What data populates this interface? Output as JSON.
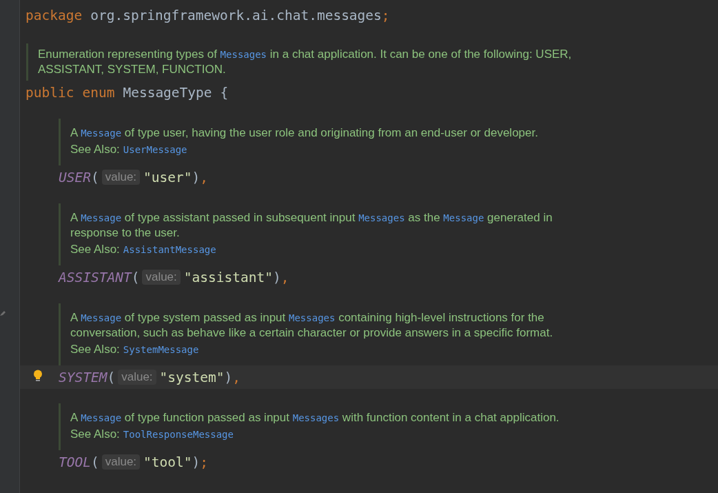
{
  "editor": {
    "package_line": {
      "keyword": "package",
      "name": "org.springframework.ai.chat.messages",
      "end": ";"
    },
    "class_doc": {
      "paragraph": [
        {
          "kind": "text",
          "text": "Enumeration representing types of "
        },
        {
          "kind": "code",
          "text": "Messages"
        },
        {
          "kind": "text",
          "text": " in a chat application. It can be one of the following: USER, ASSISTANT, SYSTEM, FUNCTION."
        }
      ]
    },
    "declaration": {
      "keywords": [
        "public",
        "enum"
      ],
      "name": "MessageType",
      "brace": "{"
    },
    "constants": [
      {
        "doc": {
          "paragraph": [
            {
              "kind": "text",
              "text": "A "
            },
            {
              "kind": "code",
              "text": "Message"
            },
            {
              "kind": "text",
              "text": " of type user, having the user role and originating from an end-user or developer."
            }
          ],
          "see_also_label": "See Also:",
          "see_also_link": "UserMessage"
        },
        "name": "USER",
        "open": "(",
        "hint": "value:",
        "value": "\"user\"",
        "close": ")",
        "end": ",",
        "current": false,
        "bulb": false
      },
      {
        "doc": {
          "paragraph": [
            {
              "kind": "text",
              "text": "A "
            },
            {
              "kind": "code",
              "text": "Message"
            },
            {
              "kind": "text",
              "text": " of type assistant passed in subsequent input "
            },
            {
              "kind": "code",
              "text": "Messages"
            },
            {
              "kind": "text",
              "text": " as the "
            },
            {
              "kind": "code",
              "text": "Message"
            },
            {
              "kind": "text",
              "text": " generated in response to the user."
            }
          ],
          "see_also_label": "See Also:",
          "see_also_link": "AssistantMessage"
        },
        "name": "ASSISTANT",
        "open": "(",
        "hint": "value:",
        "value": "\"assistant\"",
        "close": ")",
        "end": ",",
        "current": false,
        "bulb": false
      },
      {
        "doc": {
          "paragraph": [
            {
              "kind": "text",
              "text": "A "
            },
            {
              "kind": "code",
              "text": "Message"
            },
            {
              "kind": "text",
              "text": " of type system passed as input "
            },
            {
              "kind": "code",
              "text": "Messages"
            },
            {
              "kind": "text",
              "text": " containing high-level instructions for the conversation, such as behave like a certain character or provide answers in a specific format."
            }
          ],
          "see_also_label": "See Also:",
          "see_also_link": "SystemMessage"
        },
        "name": "SYSTEM",
        "open": "(",
        "hint": "value:",
        "value": "\"system\"",
        "close": ")",
        "end": ",",
        "current": true,
        "bulb": true
      },
      {
        "doc": {
          "paragraph": [
            {
              "kind": "text",
              "text": "A "
            },
            {
              "kind": "code",
              "text": "Message"
            },
            {
              "kind": "text",
              "text": " of type function passed as input "
            },
            {
              "kind": "code",
              "text": "Messages"
            },
            {
              "kind": "text",
              "text": " with function content in a chat application."
            }
          ],
          "see_also_label": "See Also:",
          "see_also_link": "ToolResponseMessage"
        },
        "name": "TOOL",
        "open": "(",
        "hint": "value:",
        "value": "\"tool\"",
        "close": ")",
        "end": ";",
        "current": false,
        "bulb": false
      }
    ]
  }
}
